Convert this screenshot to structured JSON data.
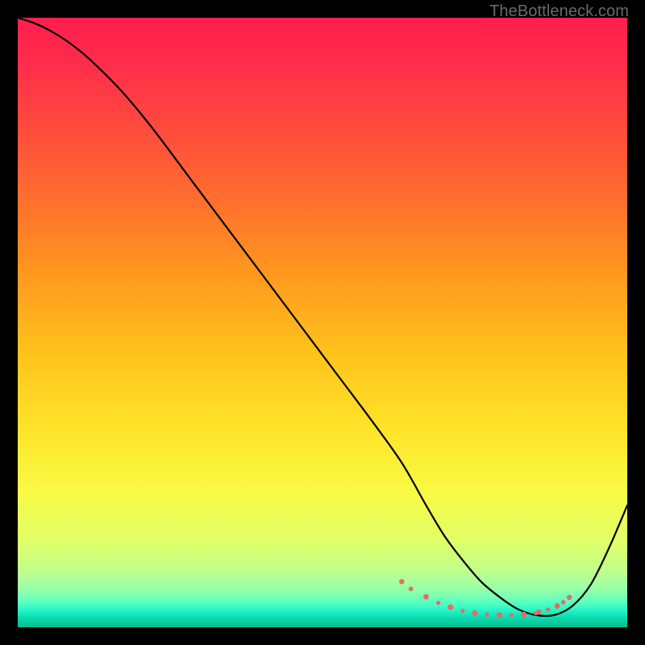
{
  "watermark": "TheBottleneck.com",
  "chart_data": {
    "type": "line",
    "title": "",
    "xlabel": "",
    "ylabel": "",
    "xlim": [
      0,
      100
    ],
    "ylim": [
      0,
      100
    ],
    "grid": false,
    "legend": false,
    "background_gradient_stops": [
      {
        "offset": 0.0,
        "color": "#ff1e4f"
      },
      {
        "offset": 0.08,
        "color": "#ff2e4a"
      },
      {
        "offset": 0.18,
        "color": "#ff4a3d"
      },
      {
        "offset": 0.3,
        "color": "#ff6f2e"
      },
      {
        "offset": 0.42,
        "color": "#ff981e"
      },
      {
        "offset": 0.55,
        "color": "#ffc21c"
      },
      {
        "offset": 0.68,
        "color": "#ffe52a"
      },
      {
        "offset": 0.78,
        "color": "#f8fa45"
      },
      {
        "offset": 0.86,
        "color": "#e0ff68"
      },
      {
        "offset": 0.905,
        "color": "#c2ff8a"
      },
      {
        "offset": 0.93,
        "color": "#a4ffa0"
      },
      {
        "offset": 0.948,
        "color": "#7dffb4"
      },
      {
        "offset": 0.962,
        "color": "#4dffc4"
      },
      {
        "offset": 0.974,
        "color": "#1ef3c6"
      },
      {
        "offset": 0.985,
        "color": "#0cd9ab"
      },
      {
        "offset": 1.0,
        "color": "#05bf90"
      }
    ],
    "series": [
      {
        "name": "bottleneck-curve",
        "color": "#000000",
        "x": [
          0,
          3,
          6,
          9,
          12,
          17,
          22,
          28,
          34,
          40,
          46,
          52,
          58,
          63,
          67,
          70,
          73,
          76,
          79,
          82,
          85,
          88,
          91,
          94,
          97,
          100
        ],
        "y": [
          100,
          99,
          97.5,
          95.5,
          93,
          88,
          82,
          74,
          66,
          58,
          50,
          42,
          34,
          27,
          20,
          15,
          11,
          7.5,
          5,
          3,
          2,
          2,
          3.5,
          7,
          13,
          20
        ]
      }
    ],
    "markers": {
      "name": "highlight-dots",
      "color": "#e86a66",
      "points_x": [
        63,
        64.5,
        67,
        69,
        71,
        73,
        75,
        77,
        79,
        81,
        83,
        85,
        85.5,
        87,
        88.5,
        89.5,
        90.5
      ],
      "points_y": [
        7.5,
        6.3,
        5.0,
        4.0,
        3.3,
        2.7,
        2.3,
        2.1,
        2.0,
        2.0,
        2.1,
        2.3,
        2.5,
        2.9,
        3.5,
        4.1,
        4.9
      ],
      "radius": [
        3.2,
        2.8,
        3.4,
        2.6,
        3.6,
        2.6,
        3.6,
        2.6,
        3.6,
        2.6,
        3.6,
        2.6,
        3.2,
        2.6,
        3.4,
        2.8,
        3.2
      ]
    }
  }
}
